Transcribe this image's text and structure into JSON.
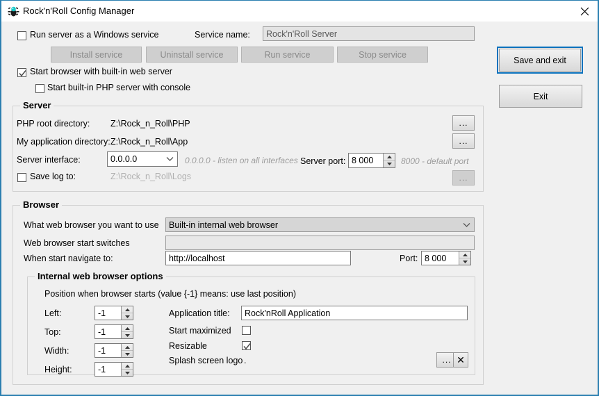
{
  "window": {
    "title": "Rock'n'Roll Config Manager",
    "app_icon": "bug-icon",
    "close_icon": "close-icon",
    "border_color": "#2b7fb0",
    "background": "#f0f0f0"
  },
  "service": {
    "run_as_service_checkbox_label": "Run server as a Windows service",
    "run_as_service_checked": false,
    "service_name_label": "Service name:",
    "service_name_value": "",
    "service_name_placeholder": "Rock'n'Roll Server",
    "buttons": [
      {
        "label": "Install service",
        "disabled": true
      },
      {
        "label": "Uninstall service",
        "disabled": true
      },
      {
        "label": "Run service",
        "disabled": true
      },
      {
        "label": "Stop service",
        "disabled": true
      }
    ],
    "start_browser_label": "Start browser with built-in web server",
    "start_browser_checked": true,
    "start_php_console_label": "Start built-in PHP server with console",
    "start_php_console_checked": false
  },
  "actions": {
    "save_and_exit_label": "Save and  exit",
    "save_and_exit_focused": true,
    "exit_label": "Exit",
    "focus_color": "#0a72bd"
  },
  "server": {
    "group_title": "Server",
    "php_root_label": "PHP root directory:",
    "php_root_value": "Z:\\Rock_n_Roll\\PHP",
    "php_root_browse_label": "...",
    "app_dir_label": "My application directory:",
    "app_dir_value": "Z:\\Rock_n_Roll\\App",
    "app_dir_browse_label": "...",
    "interface_label": "Server interface:",
    "interface_value": "0.0.0.0",
    "interface_hint": "0.0.0.0  -  listen on all interfaces",
    "port_label": "Server port:",
    "port_value": "8 000",
    "port_hint": "8000 - default port",
    "save_log_label": "Save log to:",
    "save_log_checked": false,
    "save_log_value": "Z:\\Rock_n_Roll\\Logs",
    "save_log_browse_label": "...",
    "save_log_browse_disabled": true
  },
  "browser": {
    "group_title": "Browser",
    "which_browser_label": "What web browser you want to use",
    "which_browser_value": "Built-in internal web browser",
    "start_switches_label": "Web browser start switches",
    "start_switches_value": "",
    "navigate_label": "When start navigate to:",
    "navigate_value": "http://localhost",
    "port_label": "Port:",
    "port_value": "8 000"
  },
  "internal_options": {
    "group_title": "Internal web browser options",
    "position_note": "Position when browser starts (value {-1} means: use last position)",
    "left_label": "Left:",
    "left_value": "-1",
    "top_label": "Top:",
    "top_value": "-1",
    "width_label": "Width:",
    "width_value": "-1",
    "height_label": "Height:",
    "height_value": "-1",
    "app_title_label": "Application title:",
    "app_title_value": "Rock'nRoll Application",
    "start_maximized_label": "Start maximized",
    "start_maximized_checked": false,
    "resizable_label": "Resizable",
    "resizable_checked": true,
    "splash_label": "Splash screen logo",
    "splash_value": ".",
    "splash_browse_label": "...",
    "splash_clear_label": "✕"
  }
}
